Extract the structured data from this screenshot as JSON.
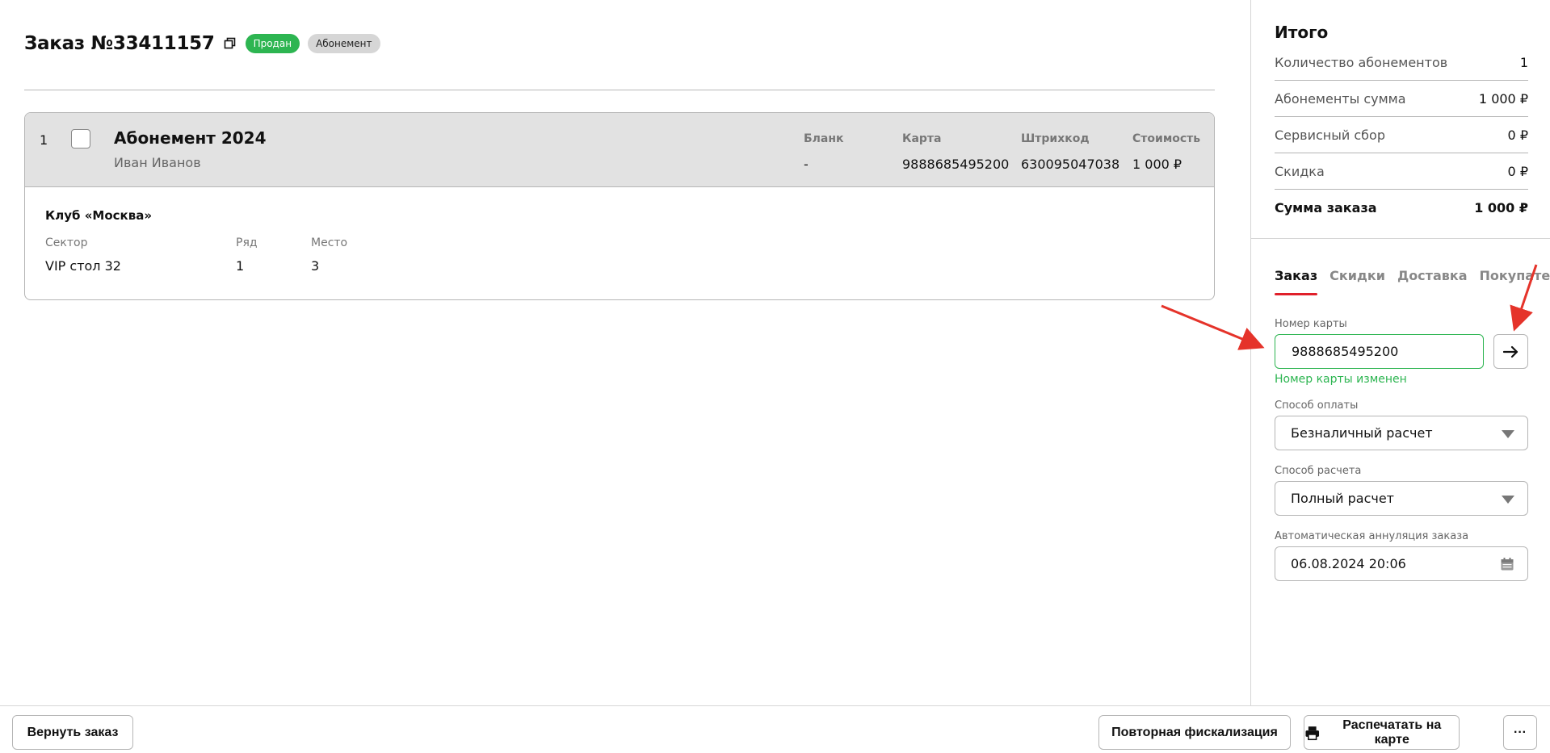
{
  "order": {
    "title": "Заказ №33411157",
    "status_badge": "Продан",
    "type_badge": "Абонемент"
  },
  "item": {
    "index": "1",
    "name": "Абонемент 2024",
    "person": "Иван Иванов",
    "columns": {
      "blank": {
        "label": "Бланк",
        "value": "-"
      },
      "card": {
        "label": "Карта",
        "value": "9888685495200"
      },
      "barcode": {
        "label": "Штрихкод",
        "value": "630095047038"
      },
      "price": {
        "label": "Стоимость",
        "value": "1 000 ₽"
      }
    },
    "club": "Клуб «Москва»",
    "seat": {
      "sector": {
        "label": "Сектор",
        "value": "VIP стол 32"
      },
      "row": {
        "label": "Ряд",
        "value": "1"
      },
      "place": {
        "label": "Место",
        "value": "3"
      }
    }
  },
  "totals": {
    "title": "Итого",
    "rows": [
      {
        "label": "Количество абонементов",
        "value": "1"
      },
      {
        "label": "Абонементы сумма",
        "value": "1 000 ₽"
      },
      {
        "label": "Сервисный сбор",
        "value": "0 ₽"
      },
      {
        "label": "Скидка",
        "value": "0 ₽"
      }
    ],
    "total": {
      "label": "Сумма заказа",
      "value": "1 000 ₽"
    }
  },
  "tabs": [
    "Заказ",
    "Скидки",
    "Доставка",
    "Покупатель"
  ],
  "form": {
    "card_number": {
      "label": "Номер карты",
      "value": "9888685495200",
      "hint": "Номер карты изменен"
    },
    "payment_method": {
      "label": "Способ оплаты",
      "value": "Безналичный расчет"
    },
    "settlement_method": {
      "label": "Способ расчета",
      "value": "Полный расчет"
    },
    "auto_cancel": {
      "label": "Автоматическая аннуляция заказа",
      "value": "06.08.2024 20:06"
    }
  },
  "bottom": {
    "return_label": "Вернуть заказ",
    "refiscal_label": "Повторная фискализация",
    "print_label": "Распечатать на карте",
    "more_label": "···"
  },
  "colors": {
    "accent_green": "#2db551",
    "tab_underline": "#e0202a",
    "arrow": "#e5332a"
  }
}
